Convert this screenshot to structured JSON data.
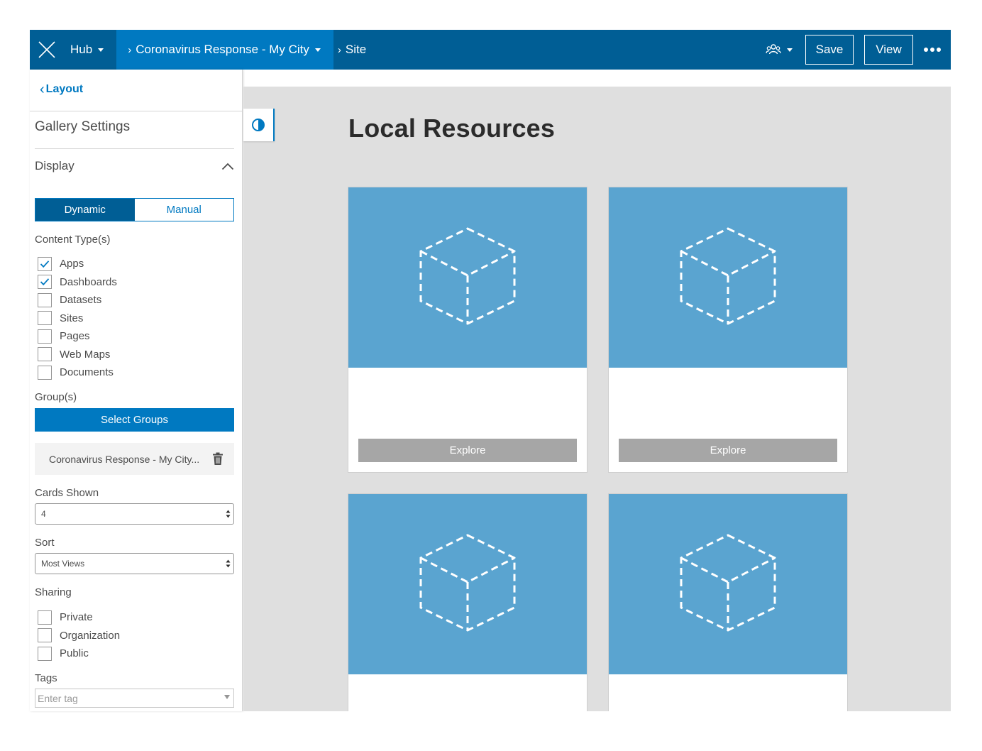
{
  "topbar": {
    "hub_label": "Hub",
    "site_crumb": "Coronavirus Response - My City",
    "page_crumb": "Site",
    "save_label": "Save",
    "view_label": "View",
    "colors": {
      "bar": "#005e95",
      "active_crumb": "#0079c1"
    }
  },
  "sidebar": {
    "back_label": "Layout",
    "title": "Gallery Settings",
    "display_label": "Display",
    "toggle": {
      "dynamic": "Dynamic",
      "manual": "Manual",
      "selected": "Dynamic"
    },
    "content_types_label": "Content Type(s)",
    "content_types": [
      {
        "label": "Apps",
        "checked": true
      },
      {
        "label": "Dashboards",
        "checked": true
      },
      {
        "label": "Datasets",
        "checked": false
      },
      {
        "label": "Sites",
        "checked": false
      },
      {
        "label": "Pages",
        "checked": false
      },
      {
        "label": "Web Maps",
        "checked": false
      },
      {
        "label": "Documents",
        "checked": false
      }
    ],
    "groups_label": "Group(s)",
    "select_groups_label": "Select Groups",
    "selected_group": "Coronavirus Response - My City...",
    "cards_shown_label": "Cards Shown",
    "cards_shown_value": "4",
    "sort_label": "Sort",
    "sort_value": "Most Views",
    "sharing_label": "Sharing",
    "sharing": [
      {
        "label": "Private",
        "checked": false
      },
      {
        "label": "Organization",
        "checked": false
      },
      {
        "label": "Public",
        "checked": false
      }
    ],
    "tags_label": "Tags",
    "tags_placeholder": "Enter tag"
  },
  "main": {
    "title": "Local Resources",
    "cards": [
      {
        "button": "Explore"
      },
      {
        "button": "Explore"
      },
      {
        "button": ""
      },
      {
        "button": ""
      }
    ],
    "colors": {
      "thumb": "#5aa4d0",
      "explore": "#a6a6a6",
      "canvas": "#dfdfdf"
    }
  }
}
